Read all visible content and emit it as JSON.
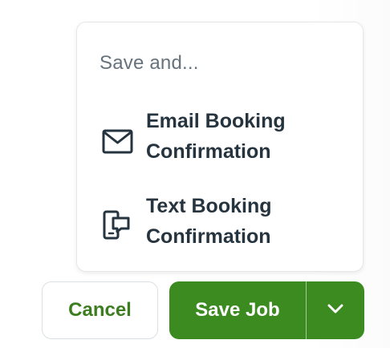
{
  "save_menu": {
    "heading": "Save and...",
    "items": [
      {
        "label": "Email Booking Confirmation",
        "icon": "envelope-icon"
      },
      {
        "label": "Text Booking Confirmation",
        "icon": "phone-message-icon"
      }
    ]
  },
  "footer": {
    "cancel_label": "Cancel",
    "save_label": "Save Job",
    "dropdown_icon": "chevron-down-icon"
  },
  "colors": {
    "accent_green": "#3b8b21",
    "cancel_text_green": "#3c7e1f",
    "menu_text": "#25343f",
    "heading_text": "#66727c"
  }
}
